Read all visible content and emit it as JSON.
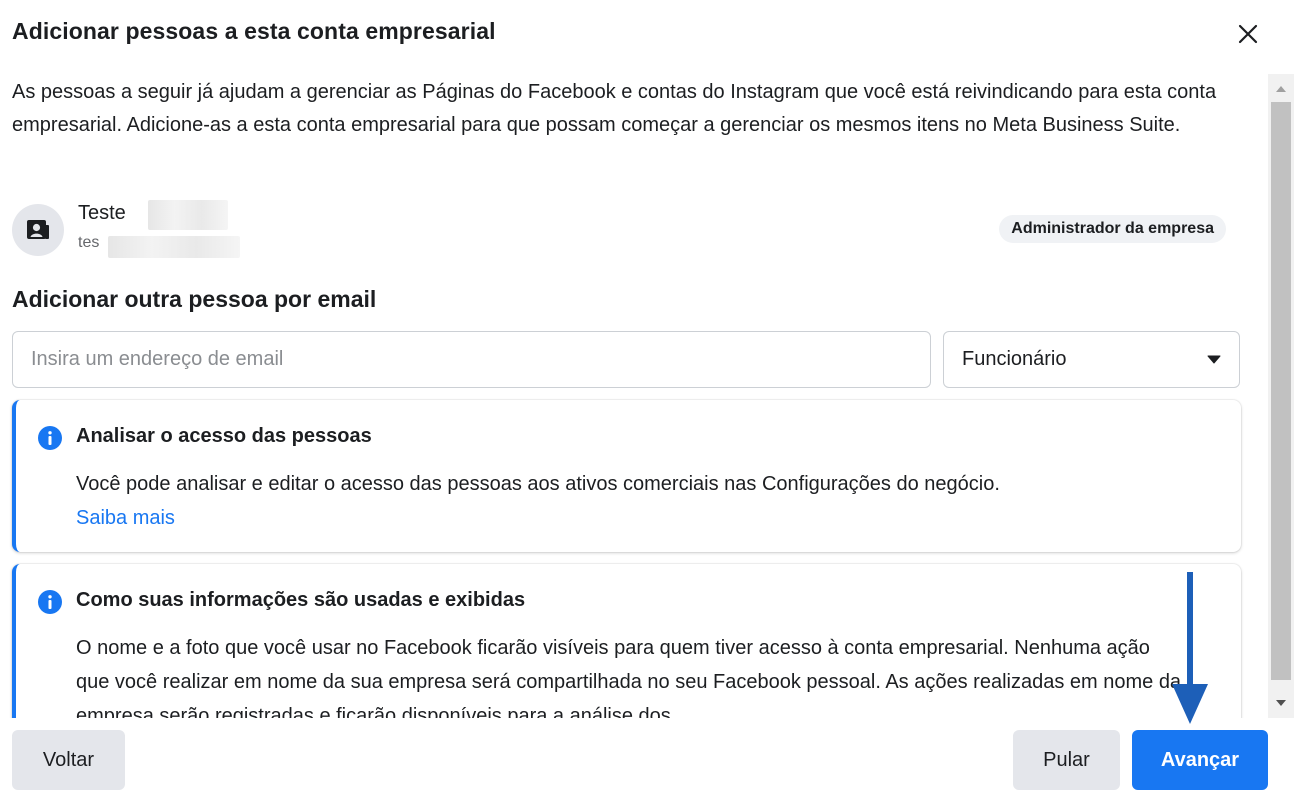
{
  "dialog": {
    "title": "Adicionar pessoas a esta conta empresarial",
    "intro": "As pessoas a seguir já ajudam a gerenciar as Páginas do Facebook e contas do Instagram que você está reivindicando para esta conta empresarial. Adicione-as a esta conta empresarial para que possam começar a gerenciar os mesmos itens no Meta Business Suite."
  },
  "person": {
    "name": "Teste",
    "email": "tes",
    "role": "Administrador da empresa"
  },
  "add_section": {
    "title": "Adicionar outra pessoa por email",
    "email_placeholder": "Insira um endereço de email",
    "email_value": "",
    "role_selected": "Funcionário"
  },
  "cards": [
    {
      "title": "Analisar o acesso das pessoas",
      "body": "Você pode analisar e editar o acesso das pessoas aos ativos comerciais nas Configurações do negócio.",
      "link": "Saiba mais"
    },
    {
      "title": "Como suas informações são usadas e exibidas",
      "body": "O nome e a foto que você usar no Facebook ficarão visíveis para quem tiver acesso à conta empresarial. Nenhuma ação que você realizar em nome da sua empresa será compartilhada no seu Facebook pessoal. As ações realizadas em nome da empresa serão registradas e ficarão disponíveis para a análise dos"
    }
  ],
  "footer": {
    "back_label": "Voltar",
    "skip_label": "Pular",
    "next_label": "Avançar"
  },
  "colors": {
    "accent": "#1877f2",
    "annotation_arrow": "#1d5fb8"
  },
  "icons": {
    "close": "close-icon",
    "avatar": "business-person-icon",
    "info": "info-icon",
    "dropdown": "caret-down-icon",
    "scroll_up": "scroll-up-icon",
    "scroll_down": "scroll-down-icon"
  }
}
